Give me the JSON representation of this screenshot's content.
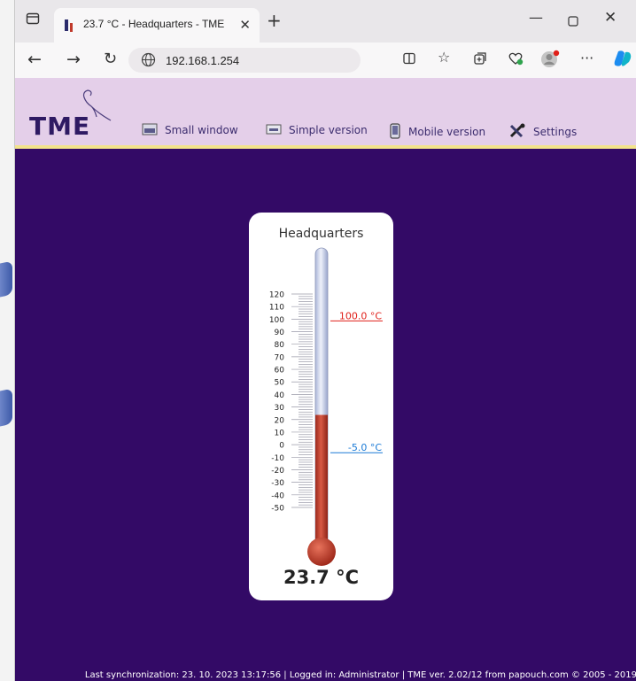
{
  "browser": {
    "tab_title": "23.7 °C - Headquarters - TME",
    "url": "192.168.1.254"
  },
  "nav": {
    "logo": "TME",
    "items": [
      {
        "label": "Small window",
        "icon": "small-window-icon"
      },
      {
        "label": "Simple version",
        "icon": "simple-version-icon"
      },
      {
        "label": "Mobile version",
        "icon": "mobile-icon"
      },
      {
        "label": "Settings",
        "icon": "settings-icon"
      }
    ]
  },
  "thermometer": {
    "name": "Headquarters",
    "reading": "23.7 °C",
    "value": 23.7,
    "scale_min": -50,
    "scale_max": 120,
    "scale_labels": [
      "120",
      "110",
      "100",
      "90",
      "80",
      "70",
      "60",
      "50",
      "40",
      "30",
      "20",
      "10",
      "0",
      "-10",
      "-20",
      "-30",
      "-40",
      "-50"
    ],
    "upper_limit": "100.0 °C",
    "upper_limit_value": 100,
    "lower_limit": "-5.0 °C",
    "lower_limit_value": -5,
    "colors": {
      "mercury": "#c0392b",
      "upper_limit": "#e0201a",
      "lower_limit": "#1a7ad6",
      "background": "#330a66"
    }
  },
  "footer": {
    "text": "Last synchronization: 23. 10. 2023 13:17:56 | Logged in: Administrator | TME ver. 2.02/12 from papouch.com © 2005 - 2019"
  }
}
